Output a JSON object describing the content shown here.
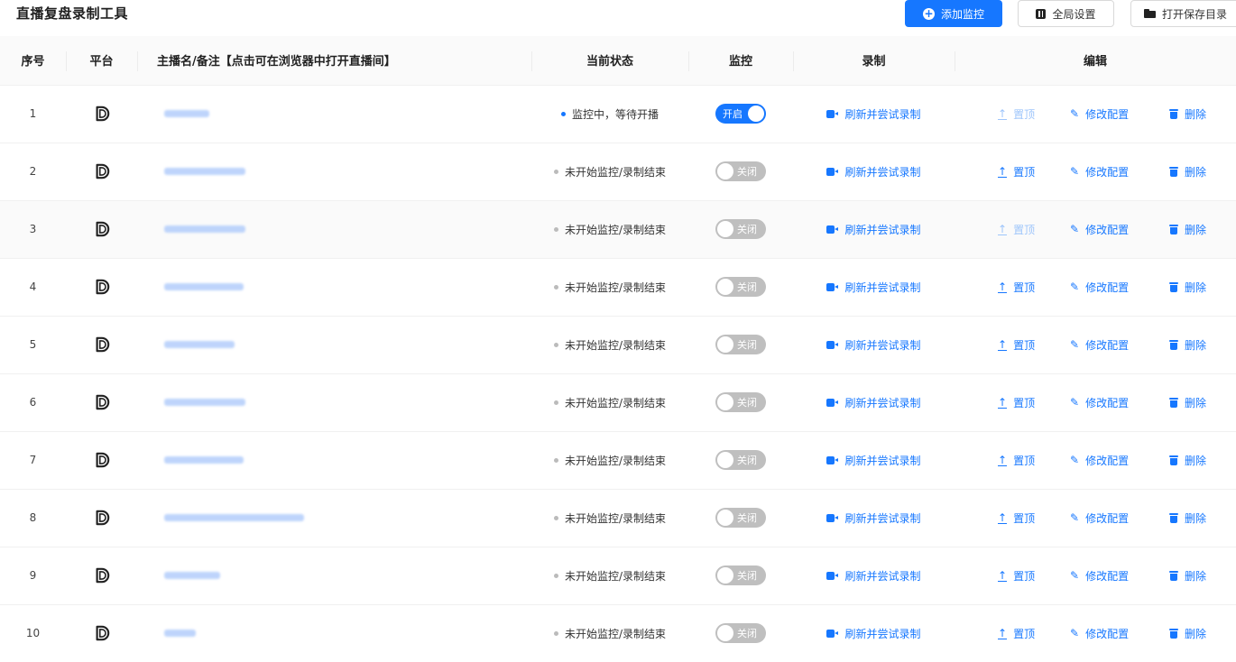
{
  "app": {
    "title": "直播复盘录制工具"
  },
  "toolbar": {
    "add_label": "添加监控",
    "settings_label": "全局设置",
    "folder_label": "打开保存目录"
  },
  "colors": {
    "accent": "#1677ff",
    "switch_off": "#bfbfbf",
    "disabled_link": "#9ec5fb"
  },
  "table": {
    "headers": [
      "序号",
      "平台",
      "主播名/备注【点击可在浏览器中打开直播间】",
      "当前状态",
      "监控",
      "录制",
      "编辑"
    ],
    "record_label": "刷新并尝试录制",
    "top_label": "置顶",
    "edit_label": "修改配置",
    "delete_label": "删除",
    "platform_icon": "douyin-d-icon",
    "rows": [
      {
        "index": "1",
        "status": "监控中，等待开播",
        "monitoring": true,
        "switch_label": "开启",
        "top_enabled": false
      },
      {
        "index": "2",
        "status": "未开始监控/录制结束",
        "monitoring": false,
        "switch_label": "关闭",
        "top_enabled": true
      },
      {
        "index": "3",
        "status": "未开始监控/录制结束",
        "monitoring": false,
        "switch_label": "关闭",
        "top_enabled": false
      },
      {
        "index": "4",
        "status": "未开始监控/录制结束",
        "monitoring": false,
        "switch_label": "关闭",
        "top_enabled": true
      },
      {
        "index": "5",
        "status": "未开始监控/录制结束",
        "monitoring": false,
        "switch_label": "关闭",
        "top_enabled": true
      },
      {
        "index": "6",
        "status": "未开始监控/录制结束",
        "monitoring": false,
        "switch_label": "关闭",
        "top_enabled": true
      },
      {
        "index": "7",
        "status": "未开始监控/录制结束",
        "monitoring": false,
        "switch_label": "关闭",
        "top_enabled": true
      },
      {
        "index": "8",
        "status": "未开始监控/录制结束",
        "monitoring": false,
        "switch_label": "关闭",
        "top_enabled": true
      },
      {
        "index": "9",
        "status": "未开始监控/录制结束",
        "monitoring": false,
        "switch_label": "关闭",
        "top_enabled": true
      },
      {
        "index": "10",
        "status": "未开始监控/录制结束",
        "monitoring": false,
        "switch_label": "关闭",
        "top_enabled": true
      }
    ]
  }
}
